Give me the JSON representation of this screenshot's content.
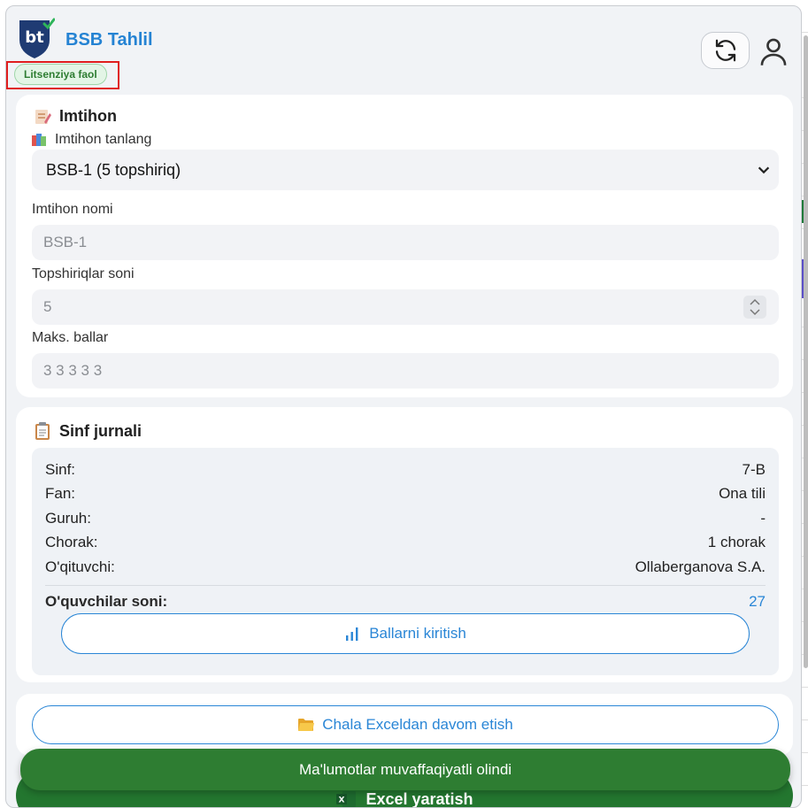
{
  "app": {
    "title": "BSB Tahlil",
    "license_badge": "Litsenziya faol"
  },
  "exam": {
    "heading": "Imtihon",
    "select_label": "Imtihon tanlang",
    "selected_exam": "BSB-1 (5 topshiriq)",
    "name_label": "Imtihon nomi",
    "name_value": "BSB-1",
    "task_count_label": "Topshiriqlar soni",
    "task_count_value": "5",
    "max_scores_label": "Maks. ballar",
    "max_scores_value": "3 3 3 3 3"
  },
  "journal": {
    "heading": "Sinf jurnali",
    "rows": [
      {
        "key": "Sinf:",
        "value": "7-B"
      },
      {
        "key": "Fan:",
        "value": "Ona tili"
      },
      {
        "key": "Guruh:",
        "value": "-"
      },
      {
        "key": "Chorak:",
        "value": "1 chorak"
      },
      {
        "key": "O'qituvchi:",
        "value": "Ollaberganova S.A."
      }
    ],
    "students_label": "O'quvchilar soni:",
    "students_value": "27",
    "enter_scores_button": "Ballarni kiritish"
  },
  "actions": {
    "continue_button": "Chala Exceldan davom etish",
    "excel_button": "Excel yaratish"
  },
  "toast": {
    "message": "Ma'lumotlar muvaffaqiyatli olindi"
  },
  "icons": {
    "exam": "memo-icon",
    "exam_select": "books-icon",
    "journal": "clipboard-icon",
    "scores": "bar-chart-icon",
    "continue": "folder-icon",
    "excel": "excel-icon",
    "refresh": "refresh-icon",
    "user": "user-icon"
  },
  "colors": {
    "accent": "#2583d3",
    "success": "#2e7d32",
    "license_frame": "#e01e1e"
  }
}
